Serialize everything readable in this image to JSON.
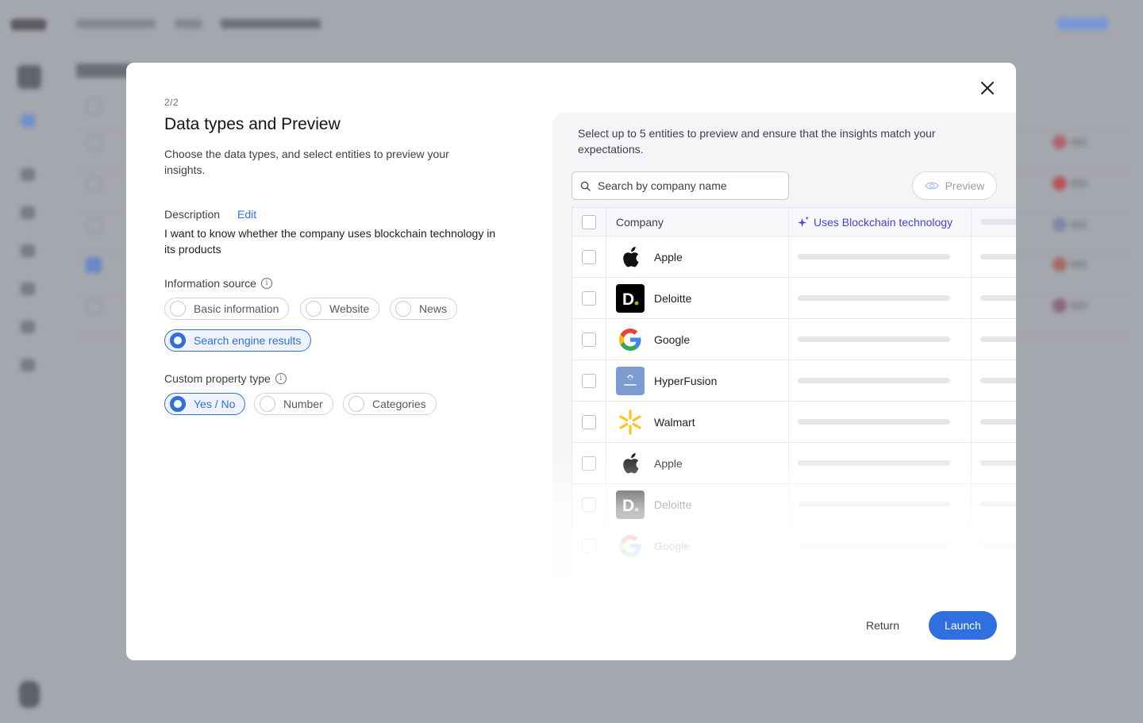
{
  "modal": {
    "step": "2/2",
    "title": "Data types and Preview",
    "subtitle": "Choose the data types, and select entities to preview your insights.",
    "description": {
      "label": "Description",
      "edit_label": "Edit",
      "text": "I want to know whether the company uses blockchain technology in its products"
    },
    "information_source": {
      "label": "Information source",
      "info_icon": "info-icon",
      "options": [
        {
          "label": "Basic information",
          "selected": false
        },
        {
          "label": "Website",
          "selected": false
        },
        {
          "label": "News",
          "selected": false
        },
        {
          "label": "Search engine results",
          "selected": true
        }
      ]
    },
    "custom_property_type": {
      "label": "Custom property type",
      "info_icon": "info-icon",
      "options": [
        {
          "label": "Yes / No",
          "selected": true
        },
        {
          "label": "Number",
          "selected": false
        },
        {
          "label": "Categories",
          "selected": false
        }
      ]
    },
    "preview_panel": {
      "intro": "Select up to 5 entities to preview and ensure that the insights match your expectations.",
      "search_placeholder": "Search by company name",
      "preview_label": "Preview",
      "table": {
        "columns": {
          "company": "Company",
          "property": "Uses Blockchain technology"
        },
        "rows": [
          {
            "name": "Apple",
            "logo": "apple-logo"
          },
          {
            "name": "Deloitte",
            "logo": "deloitte-logo"
          },
          {
            "name": "Google",
            "logo": "google-logo"
          },
          {
            "name": "HyperFusion",
            "logo": "hyperfusion-logo"
          },
          {
            "name": "Walmart",
            "logo": "walmart-logo"
          },
          {
            "name": "Apple",
            "logo": "apple-logo"
          },
          {
            "name": "Deloitte",
            "logo": "deloitte-logo"
          },
          {
            "name": "Google",
            "logo": "google-logo"
          }
        ]
      }
    },
    "footer": {
      "return_label": "Return",
      "launch_label": "Launch"
    },
    "colors": {
      "accent": "#2f6fe0",
      "property_accent": "#4b3fd6"
    }
  }
}
